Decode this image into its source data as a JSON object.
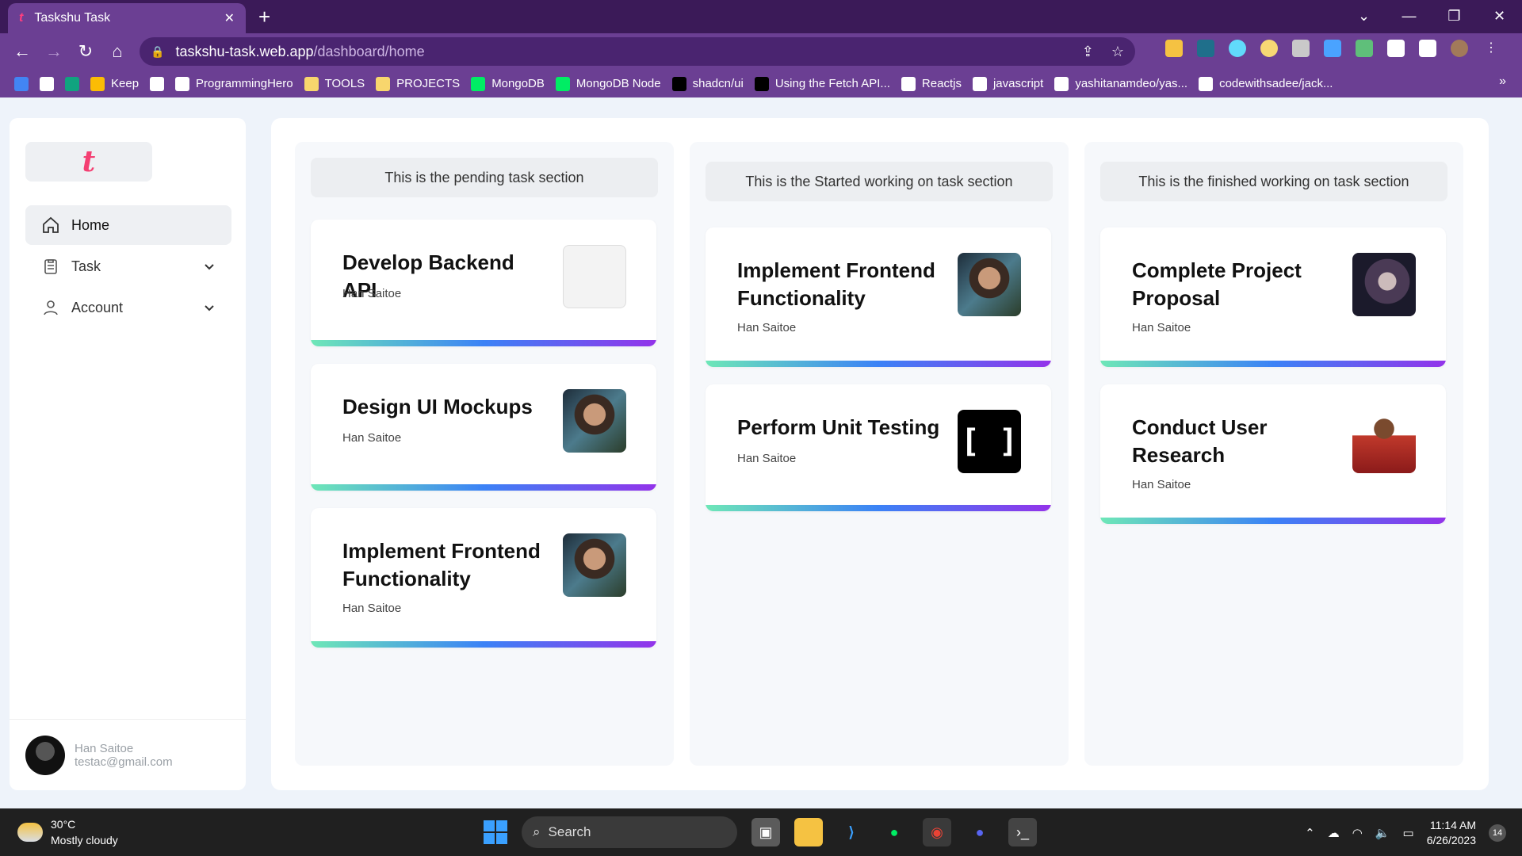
{
  "browser": {
    "tab_title": "Taskshu Task",
    "url_host": "taskshu-task.web.app",
    "url_path": "/dashboard/home",
    "bookmarks": [
      {
        "label": "",
        "color": "#4285f4"
      },
      {
        "label": "",
        "color": "#ffffff"
      },
      {
        "label": "",
        "color": "#10a37f"
      },
      {
        "label": "Keep",
        "color": "#fbbc04"
      },
      {
        "label": "",
        "color": "#ffffff"
      },
      {
        "label": "ProgrammingHero",
        "color": "#ffffff"
      },
      {
        "label": "TOOLS",
        "color": "#f8d66d"
      },
      {
        "label": "PROJECTS",
        "color": "#f8d66d"
      },
      {
        "label": "MongoDB",
        "color": "#00ed64"
      },
      {
        "label": "MongoDB Node",
        "color": "#00ed64"
      },
      {
        "label": "shadcn/ui",
        "color": "#000000"
      },
      {
        "label": "Using the Fetch API...",
        "color": "#000000"
      },
      {
        "label": "Reactjs",
        "color": "#ffffff"
      },
      {
        "label": "javascript",
        "color": "#ffffff"
      },
      {
        "label": "yashitanamdeo/yas...",
        "color": "#ffffff"
      },
      {
        "label": "codewithsadee/jack...",
        "color": "#ffffff"
      }
    ],
    "bookmarks_more": "»"
  },
  "app": {
    "logo_letter": "t",
    "nav": [
      {
        "label": "Home",
        "icon": "home-icon",
        "active": true
      },
      {
        "label": "Task",
        "icon": "clipboard-icon",
        "active": false
      },
      {
        "label": "Account",
        "icon": "user-icon",
        "active": false
      }
    ],
    "user": {
      "name": "Han Saitoe",
      "email": "testac@gmail.com"
    }
  },
  "columns": [
    {
      "heading": "This is the pending task section",
      "cards": [
        {
          "title": "Develop Backend API",
          "user": "Han Saitoe",
          "image": "diagram"
        },
        {
          "title": "Design UI Mockups",
          "user": "Han Saitoe",
          "image": "photo"
        },
        {
          "title": "Implement Frontend Functionality",
          "user": "Han Saitoe",
          "image": "photo"
        }
      ]
    },
    {
      "heading": "This is the Started working on task section",
      "cards": [
        {
          "title": "Implement Frontend Functionality",
          "user": "Han Saitoe",
          "image": "photo"
        },
        {
          "title": "Perform Unit Testing",
          "user": "Han Saitoe",
          "image": "brackets",
          "image_text": "[ ]"
        }
      ]
    },
    {
      "heading": "This is the finished working on task section",
      "cards": [
        {
          "title": "Complete Project Proposal",
          "user": "Han Saitoe",
          "image": "space"
        },
        {
          "title": "Conduct User Research",
          "user": "Han Saitoe",
          "image": "person"
        }
      ]
    }
  ],
  "taskbar": {
    "temp": "30°C",
    "weather": "Mostly cloudy",
    "search": "Search",
    "time": "11:14 AM",
    "date": "6/26/2023",
    "notifications": "14"
  }
}
